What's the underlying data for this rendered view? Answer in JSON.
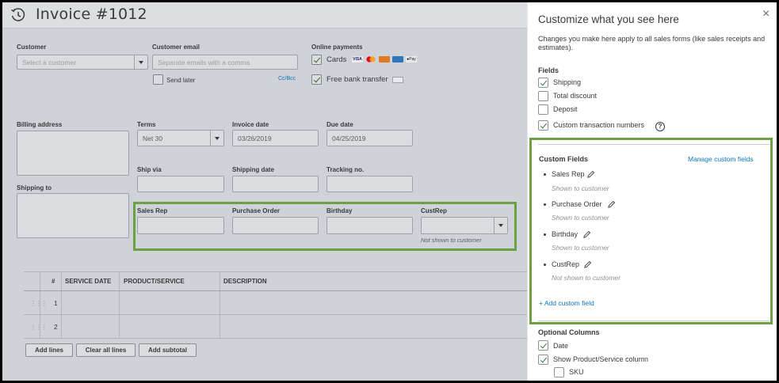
{
  "invoice": {
    "title": "Invoice #1012",
    "customer": {
      "label": "Customer",
      "placeholder": "Select a customer"
    },
    "customer_email": {
      "label": "Customer email",
      "placeholder": "Separate emails with a comma",
      "send_later": "Send later",
      "cc_bcc": "Cc/Bcc"
    },
    "online_payments": {
      "label": "Online payments",
      "cards": "Cards",
      "free_bank_transfer": "Free bank transfer",
      "cards_checked": true,
      "bank_checked": true
    },
    "billing_address": {
      "label": "Billing address"
    },
    "terms": {
      "label": "Terms",
      "value": "Net 30"
    },
    "invoice_date": {
      "label": "Invoice date",
      "value": "03/26/2019"
    },
    "due_date": {
      "label": "Due date",
      "value": "04/25/2019"
    },
    "ship_via": {
      "label": "Ship via"
    },
    "shipping_date": {
      "label": "Shipping date"
    },
    "tracking_no": {
      "label": "Tracking no."
    },
    "shipping_to": {
      "label": "Shipping to"
    },
    "custom_fields": [
      {
        "label": "Sales Rep"
      },
      {
        "label": "Purchase Order"
      },
      {
        "label": "Birthday"
      },
      {
        "label": "CustRep",
        "note": "Not shown to customer"
      }
    ],
    "table": {
      "headers": [
        "#",
        "SERVICE DATE",
        "PRODUCT/SERVICE",
        "DESCRIPTION"
      ],
      "rows": [
        {
          "num": "1"
        },
        {
          "num": "2"
        }
      ]
    },
    "buttons": {
      "add_lines": "Add lines",
      "clear_all_lines": "Clear all lines",
      "add_subtotal": "Add subtotal"
    }
  },
  "panel": {
    "title": "Customize what you see here",
    "close": "×",
    "description": "Changes you make here apply to all sales forms (like sales receipts and estimates).",
    "fields_heading": "Fields",
    "fields": [
      {
        "label": "Shipping",
        "checked": true
      },
      {
        "label": "Total discount",
        "checked": false
      },
      {
        "label": "Deposit",
        "checked": false
      },
      {
        "label": "Custom transaction numbers",
        "checked": true
      }
    ],
    "custom_fields_heading": "Custom Fields",
    "manage_link": "Manage custom fields",
    "custom_fields": [
      {
        "name": "Sales Rep",
        "visibility": "Shown to customer"
      },
      {
        "name": "Purchase Order",
        "visibility": "Shown to customer"
      },
      {
        "name": "Birthday",
        "visibility": "Shown to customer"
      },
      {
        "name": "CustRep",
        "visibility": "Not shown to customer"
      }
    ],
    "add_custom_field": "+ Add custom field",
    "optional_columns_heading": "Optional Columns",
    "optional_columns": [
      {
        "label": "Date",
        "checked": true
      },
      {
        "label": "Show Product/Service column",
        "checked": true
      },
      {
        "label": "SKU",
        "checked": false
      }
    ]
  },
  "colors": {
    "highlight": "#6ba043",
    "link": "#0d76bd",
    "text": "#393a3d"
  }
}
